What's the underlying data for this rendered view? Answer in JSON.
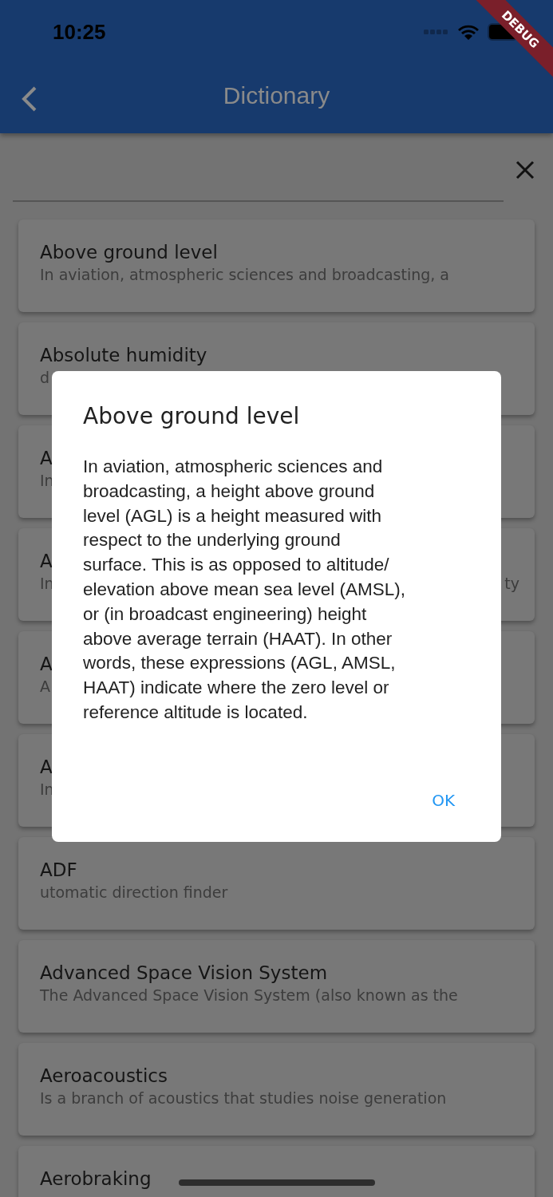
{
  "status_bar": {
    "time": "10:25"
  },
  "debug_banner": "DEBUG",
  "app_bar": {
    "title": "Dictionary"
  },
  "entries": [
    {
      "title": "Above ground level",
      "subtitle": "In aviation, atmospheric sciences and broadcasting, a"
    },
    {
      "title": "Absolute humidity",
      "subtitle": "d"
    },
    {
      "title": "A",
      "subtitle": "In"
    },
    {
      "title": "A",
      "subtitle": "In",
      "subtitle_end": "ty"
    },
    {
      "title": "A",
      "subtitle": "A"
    },
    {
      "title": "A",
      "subtitle": "In"
    },
    {
      "title": "ADF",
      "subtitle": "utomatic direction finder"
    },
    {
      "title": "Advanced Space Vision System",
      "subtitle": "The Advanced Space Vision System (also known as the"
    },
    {
      "title": "Aeroacoustics",
      "subtitle": "Is a branch of acoustics that studies noise generation"
    },
    {
      "title": "Aerobraking"
    }
  ],
  "dialog": {
    "title": "Above ground level",
    "body": "In aviation, atmospheric sciences and\nbroadcasting, a height above ground\nlevel (AGL) is a height measured with\nrespect to the underlying ground\nsurface. This is as opposed to altitude/\nelevation above mean sea level (AMSL),\nor (in broadcast engineering) height\nabove average terrain (HAAT). In other\nwords, these expressions (AGL, AMSL,\nHAAT) indicate where the zero level or\nreference altitude is located.",
    "button": "OK"
  }
}
